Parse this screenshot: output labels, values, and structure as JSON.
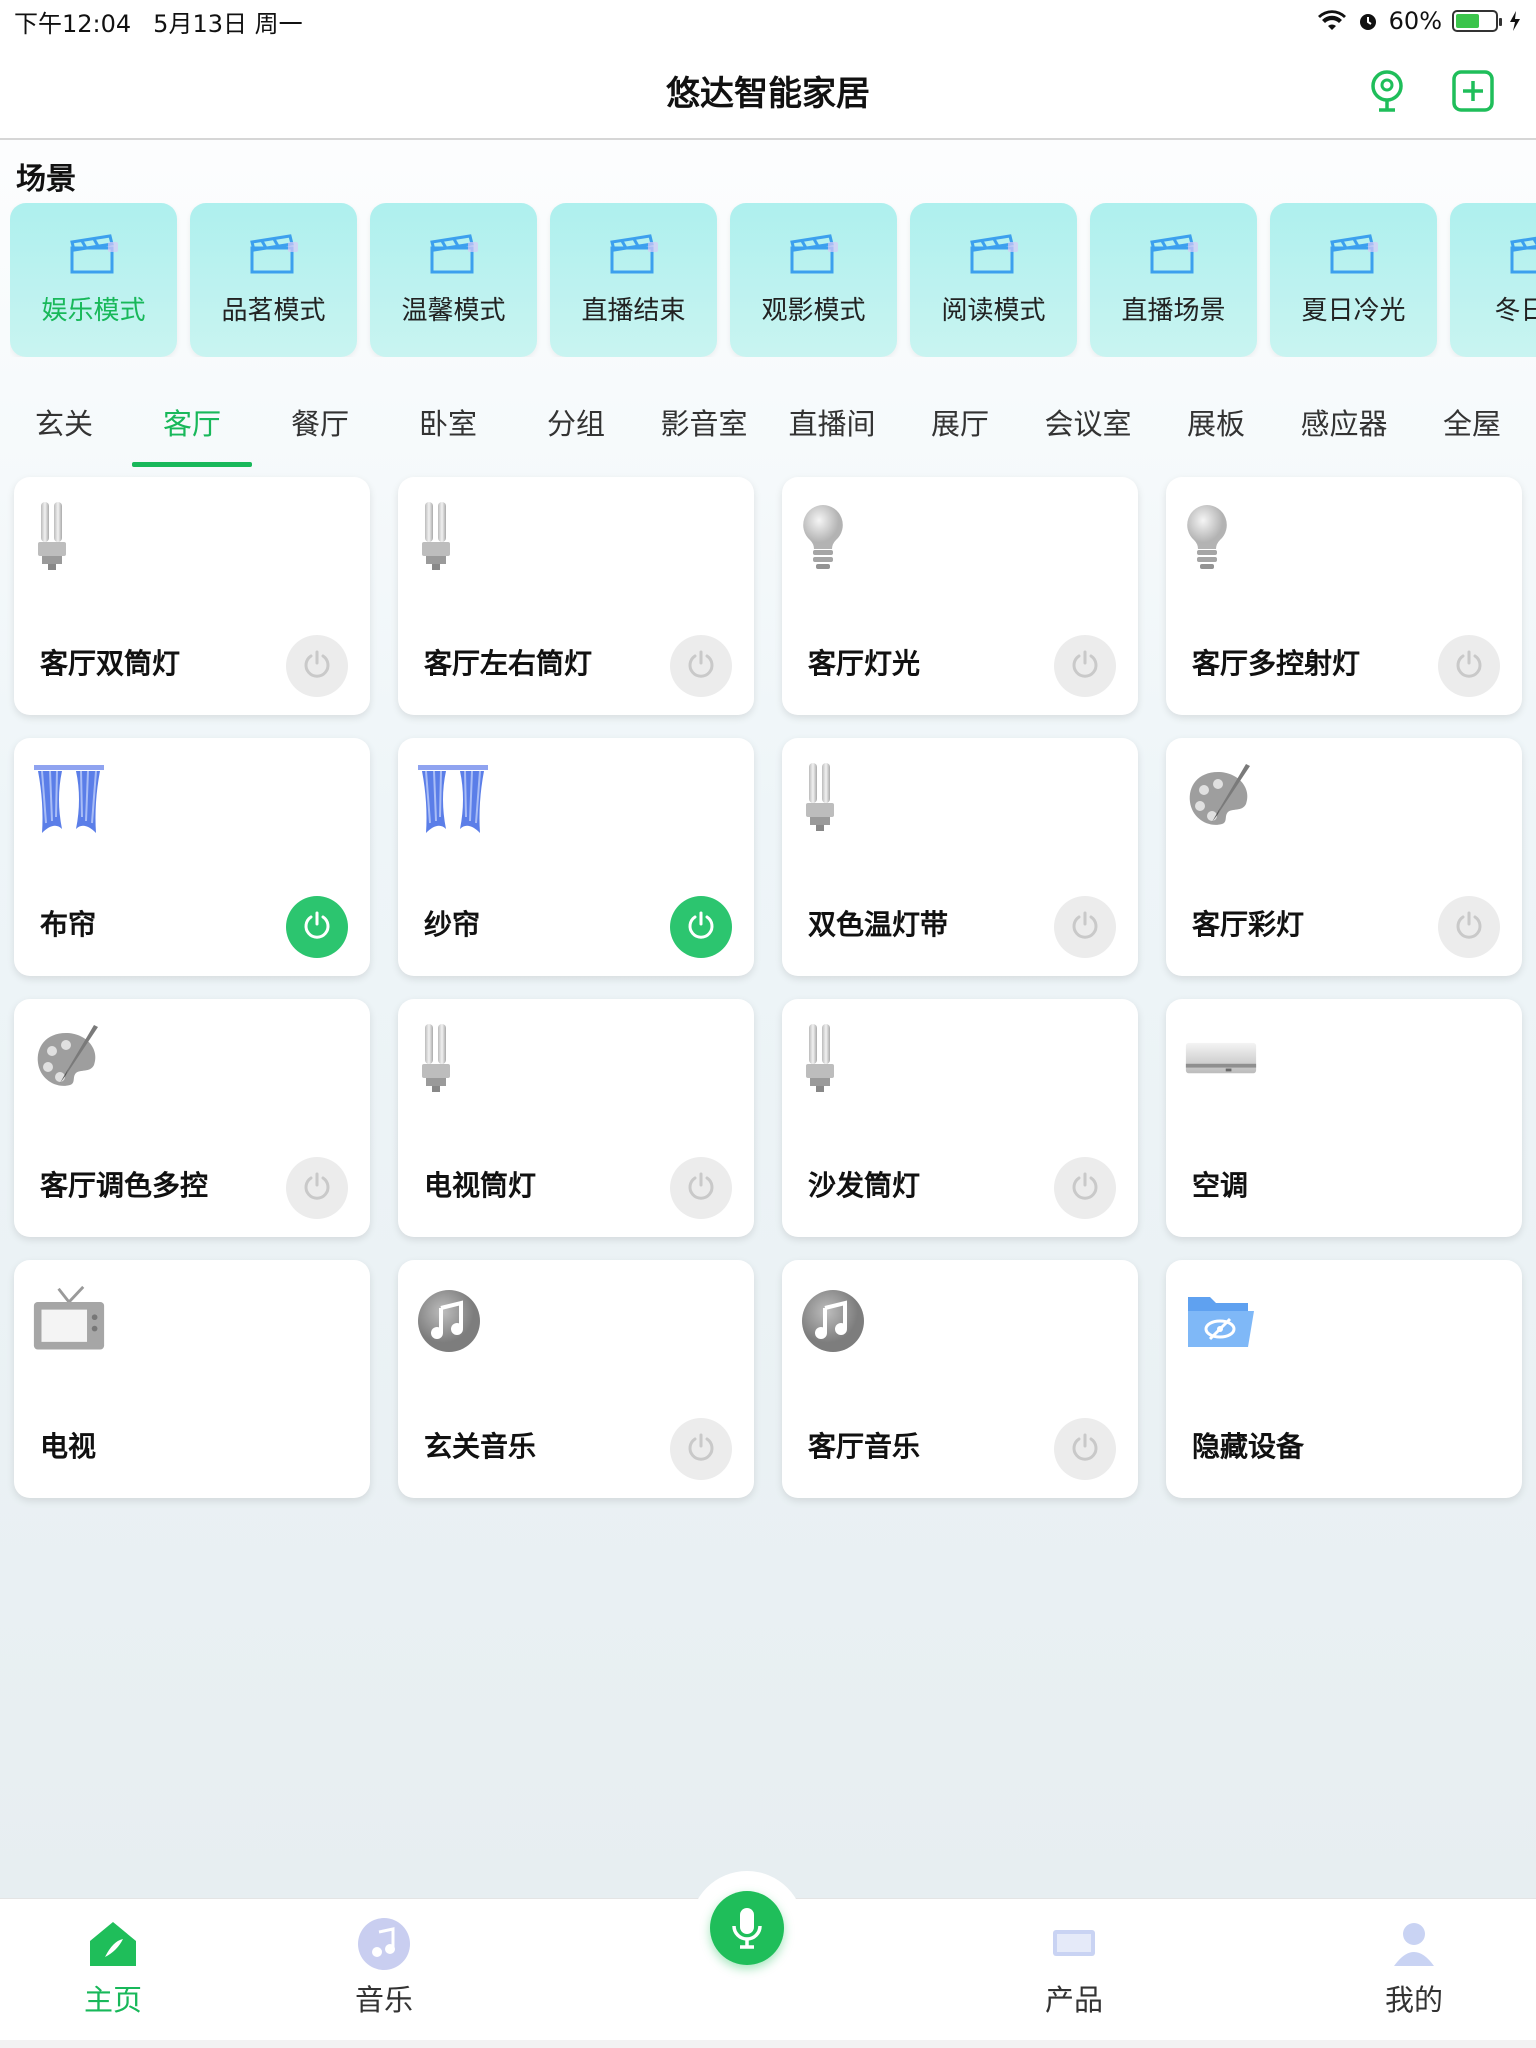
{
  "status": {
    "time": "下午12:04",
    "date": "5月13日 周一",
    "battery": "60%",
    "battery_level": 0.6
  },
  "header": {
    "title": "悠达智能家居"
  },
  "scenes": {
    "title": "场景",
    "items": [
      {
        "label": "娱乐模式",
        "active": true
      },
      {
        "label": "品茗模式",
        "active": false
      },
      {
        "label": "温馨模式",
        "active": false
      },
      {
        "label": "直播结束",
        "active": false
      },
      {
        "label": "观影模式",
        "active": false
      },
      {
        "label": "阅读模式",
        "active": false
      },
      {
        "label": "直播场景",
        "active": false
      },
      {
        "label": "夏日冷光",
        "active": false
      },
      {
        "label": "冬日暖",
        "active": false
      }
    ]
  },
  "rooms": {
    "tabs": [
      "玄关",
      "客厅",
      "餐厅",
      "卧室",
      "分组",
      "影音室",
      "直播间",
      "展厅",
      "会议室",
      "展板",
      "感应器",
      "全屋"
    ],
    "active": "客厅"
  },
  "devices": [
    {
      "name": "客厅双筒灯",
      "icon": "tube-lamp-icon",
      "power": "off"
    },
    {
      "name": "客厅左右筒灯",
      "icon": "tube-lamp-icon",
      "power": "off"
    },
    {
      "name": "客厅灯光",
      "icon": "bulb-icon",
      "power": "off"
    },
    {
      "name": "客厅多控射灯",
      "icon": "bulb-icon",
      "power": "off"
    },
    {
      "name": "布帘",
      "icon": "curtain-icon",
      "power": "on"
    },
    {
      "name": "纱帘",
      "icon": "curtain-icon",
      "power": "on"
    },
    {
      "name": "双色温灯带",
      "icon": "tube-lamp-icon",
      "power": "off"
    },
    {
      "name": "客厅彩灯",
      "icon": "palette-icon",
      "power": "off"
    },
    {
      "name": "客厅调色多控",
      "icon": "palette-icon",
      "power": "off"
    },
    {
      "name": "电视筒灯",
      "icon": "tube-lamp-icon",
      "power": "off"
    },
    {
      "name": "沙发筒灯",
      "icon": "tube-lamp-icon",
      "power": "off"
    },
    {
      "name": "空调",
      "icon": "air-conditioner-icon",
      "power": "none"
    },
    {
      "name": "电视",
      "icon": "tv-icon",
      "power": "none"
    },
    {
      "name": "玄关音乐",
      "icon": "music-icon",
      "power": "off"
    },
    {
      "name": "客厅音乐",
      "icon": "music-icon",
      "power": "off"
    },
    {
      "name": "隐藏设备",
      "icon": "hidden-folder-icon",
      "power": "none"
    }
  ],
  "nav": {
    "home": "主页",
    "music": "音乐",
    "products": "产品",
    "mine": "我的"
  },
  "colors": {
    "accent": "#18b85a",
    "power_on": "#2cc56f",
    "scene_card": "#b8f1ee"
  }
}
